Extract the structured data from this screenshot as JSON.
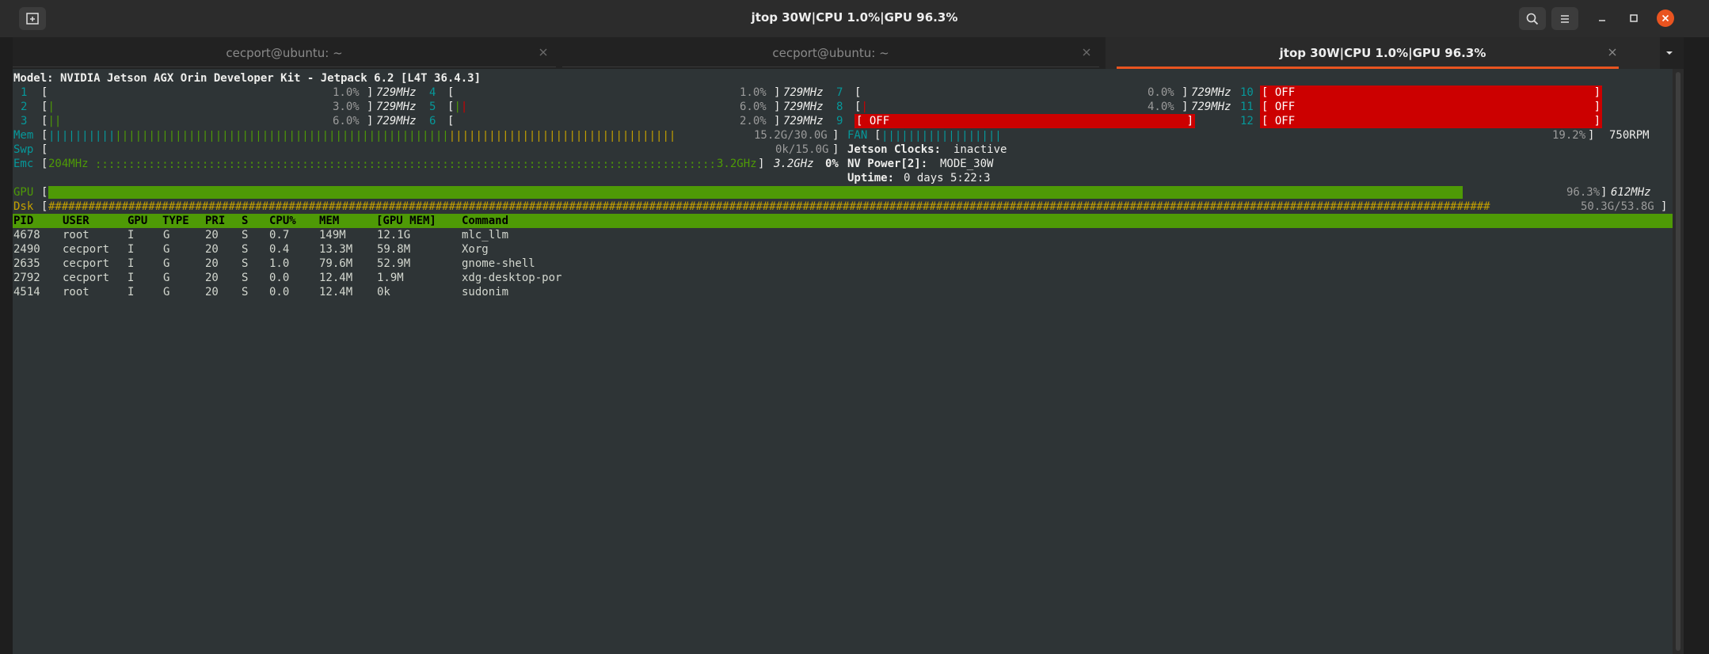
{
  "window": {
    "title": "jtop 30W|CPU 1.0%|GPU 96.3%",
    "icons": [
      "new-tab-icon",
      "search-icon",
      "hamburger-menu-icon",
      "minimize-icon",
      "maximize-icon",
      "close-icon"
    ]
  },
  "tabs": [
    {
      "label": "cecport@ubuntu: ~",
      "active": false
    },
    {
      "label": "cecport@ubuntu: ~",
      "active": false
    },
    {
      "label": "jtop 30W|CPU 1.0%|GPU 96.3%",
      "active": true
    }
  ],
  "colors": {
    "accent": "#e95420",
    "terminal_bg": "#2e3436",
    "green": "#4e9a06",
    "red": "#cc0000",
    "cyan": "#06989a",
    "yellow": "#c4a000"
  },
  "jtop": {
    "model": "Model: NVIDIA Jetson AGX Orin Developer Kit - Jetpack 6.2 [L4T 36.4.3]",
    "cpus": [
      {
        "id": "1",
        "percent": "1.0%",
        "freq": "729MHz"
      },
      {
        "id": "2",
        "percent": "3.0%",
        "freq": "729MHz"
      },
      {
        "id": "3",
        "percent": "6.0%",
        "freq": "729MHz"
      },
      {
        "id": "4",
        "percent": "1.0%",
        "freq": "729MHz"
      },
      {
        "id": "5",
        "percent": "6.0%",
        "freq": "729MHz"
      },
      {
        "id": "6",
        "percent": "2.0%",
        "freq": "729MHz"
      },
      {
        "id": "7",
        "percent": "0.0%",
        "freq": "729MHz"
      },
      {
        "id": "8",
        "percent": "4.0%",
        "freq": "729MHz"
      },
      {
        "id": "9",
        "off": "OFF"
      },
      {
        "id": "10",
        "off": "OFF"
      },
      {
        "id": "11",
        "off": "OFF"
      },
      {
        "id": "12",
        "off": "OFF"
      }
    ],
    "mem": {
      "label": "Mem",
      "value": "15.2G/30.0G"
    },
    "swp": {
      "label": "Swp",
      "value": "0k/15.0G"
    },
    "emc": {
      "label": "Emc",
      "min": "204MHz",
      "max": "3.2GHz",
      "freq": "3.2GHz",
      "percent": "0%"
    },
    "fan": {
      "label": "FAN",
      "percent": "19.2%",
      "rpm": "750RPM"
    },
    "jetson_clocks": {
      "label": "Jetson Clocks:",
      "value": "inactive"
    },
    "nv_power": {
      "label": "NV Power[2]:",
      "value": "MODE_30W"
    },
    "uptime": {
      "label": "Uptime:",
      "value": "0 days 5:22:3"
    },
    "gpu": {
      "label": "GPU",
      "percent": "96.3%",
      "freq": "612MHz",
      "fill_fraction": 0.963
    },
    "dsk": {
      "label": "Dsk",
      "value": "50.3G/53.8G",
      "fill_fraction": 0.935
    },
    "process_headers": [
      "PID",
      "USER",
      "GPU",
      "TYPE",
      "PRI",
      "S",
      "CPU%",
      "MEM",
      "[GPU MEM]",
      "Command"
    ],
    "processes": [
      [
        "4678",
        "root",
        "I",
        "G",
        "20",
        "S",
        "0.7",
        "149M",
        "12.1G",
        "mlc_llm"
      ],
      [
        "2490",
        "cecport",
        "I",
        "G",
        "20",
        "S",
        "0.4",
        "13.3M",
        "59.8M",
        "Xorg"
      ],
      [
        "2635",
        "cecport",
        "I",
        "G",
        "20",
        "S",
        "1.0",
        "79.6M",
        "52.9M",
        "gnome-shell"
      ],
      [
        "2792",
        "cecport",
        "I",
        "G",
        "20",
        "S",
        "0.0",
        "12.4M",
        "1.9M",
        "xdg-desktop-por"
      ],
      [
        "4514",
        "root",
        "I",
        "G",
        "20",
        "S",
        "0.0",
        "12.4M",
        "0k",
        "sudonim"
      ]
    ]
  }
}
